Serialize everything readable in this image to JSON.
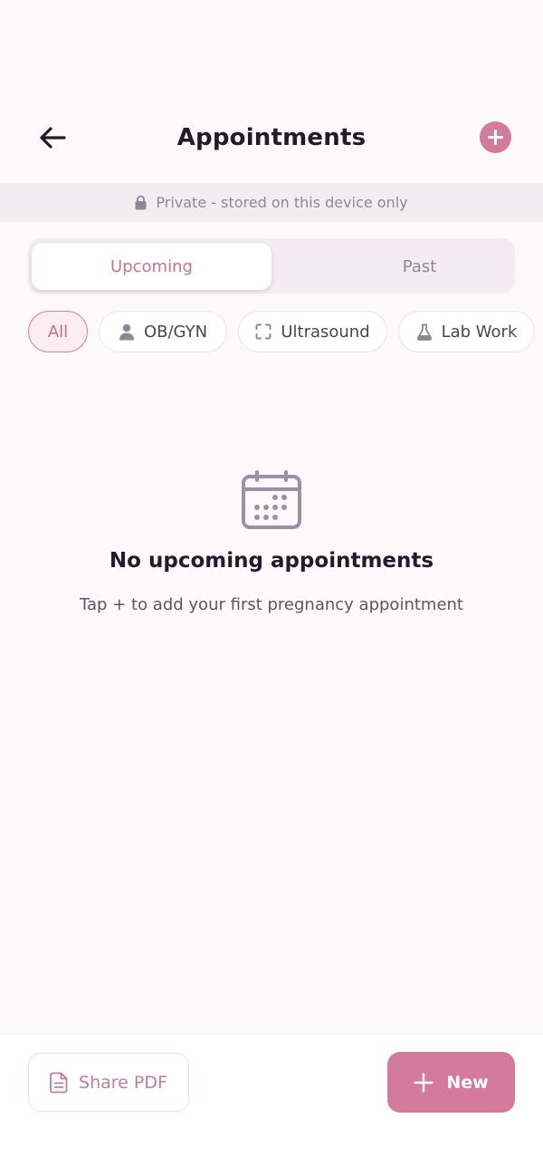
{
  "header": {
    "title": "Appointments",
    "back_icon": "arrow-left-icon",
    "add_icon": "plus-icon"
  },
  "privacy": {
    "text": "Private - stored on this device only",
    "icon": "lock-icon"
  },
  "tabs": [
    {
      "label": "Upcoming",
      "active": true
    },
    {
      "label": "Past",
      "active": false
    }
  ],
  "filters": [
    {
      "label": "All",
      "icon": "",
      "active": true
    },
    {
      "label": "OB/GYN",
      "icon": "person-icon",
      "active": false
    },
    {
      "label": "Ultrasound",
      "icon": "scan-frame-icon",
      "active": false
    },
    {
      "label": "Lab Work",
      "icon": "flask-icon",
      "active": false
    }
  ],
  "empty_state": {
    "icon": "calendar-icon",
    "title": "No upcoming appointments",
    "subtitle": "Tap + to add your first pregnancy appointment"
  },
  "bottom_bar": {
    "share_label": "Share PDF",
    "share_icon": "document-icon",
    "new_label": "New",
    "new_icon": "plus-icon"
  },
  "colors": {
    "accent": "#d47a9c",
    "background": "#fdf8f9",
    "banner": "#f4ecf0",
    "text_primary": "#231b2c",
    "text_muted": "#8d8796"
  }
}
